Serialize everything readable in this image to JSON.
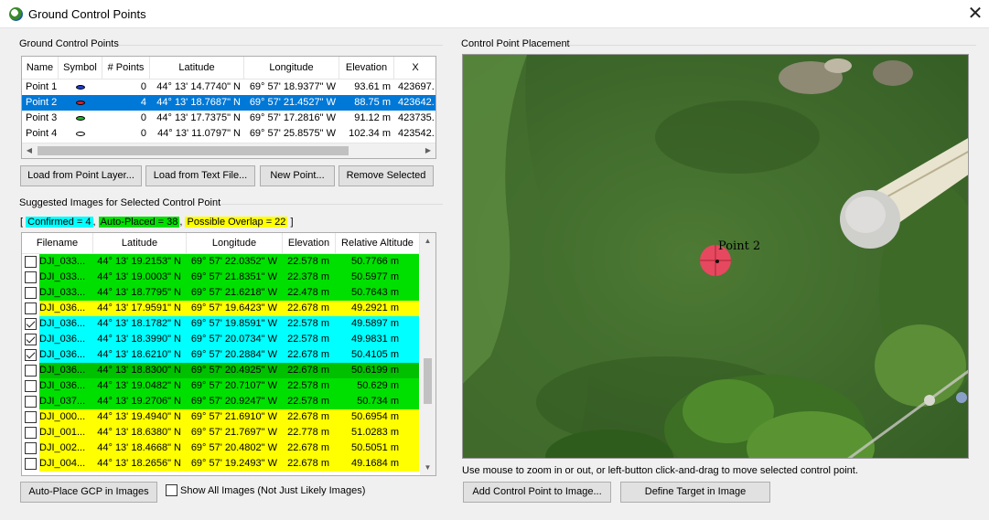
{
  "window": {
    "title": "Ground Control Points",
    "close_glyph": "✕"
  },
  "gcp_group": {
    "label": "Ground Control Points",
    "columns": [
      "Name",
      "Symbol",
      "# Points",
      "Latitude",
      "Longitude",
      "Elevation",
      "X"
    ],
    "rows": [
      {
        "name": "Point 1",
        "symbol_color": "#1a3fd6",
        "points": "0",
        "lat": "44° 13' 14.7740\" N",
        "lon": "69° 57' 18.9377\" W",
        "elev": "93.61 m",
        "x": "423697.",
        "selected": false
      },
      {
        "name": "Point 2",
        "symbol_color": "#e01e2e",
        "points": "4",
        "lat": "44° 13' 18.7687\" N",
        "lon": "69° 57' 21.4527\" W",
        "elev": "88.75 m",
        "x": "423642.",
        "selected": true
      },
      {
        "name": "Point 3",
        "symbol_color": "#1fb52a",
        "points": "0",
        "lat": "44° 13' 17.7375\" N",
        "lon": "69° 57' 17.2816\" W",
        "elev": "91.12 m",
        "x": "423735.",
        "selected": false
      },
      {
        "name": "Point 4",
        "symbol_color": "#ffffff",
        "points": "0",
        "lat": "44° 13' 11.0797\" N",
        "lon": "69° 57' 25.8575\" W",
        "elev": "102.34 m",
        "x": "423542.",
        "selected": false
      }
    ],
    "buttons": {
      "load_point_layer": "Load from Point Layer...",
      "load_text_file": "Load from Text File...",
      "new_point": "New Point...",
      "remove_selected": "Remove Selected"
    }
  },
  "images_group": {
    "label": "Suggested Images for Selected Control Point",
    "legend": {
      "open": "[",
      "confirmed": "Confirmed = 4",
      "auto_placed": "Auto-Placed = 38",
      "overlap": "Possible Overlap = 22",
      "close": "]",
      "sep": ","
    },
    "colors": {
      "confirmed": "#00ffff",
      "auto_placed": "#00e000",
      "overlap": "#ffff00",
      "selected_row": "#00c000"
    },
    "columns": [
      "Filename",
      "Latitude",
      "Longitude",
      "Elevation",
      "Relative Altitude"
    ],
    "rows": [
      {
        "file": "DJI_033...",
        "lat": "44° 13' 19.2153\" N",
        "lon": "69° 57' 22.0352\" W",
        "elev": "22.578 m",
        "rel": "50.7766 m",
        "checked": false,
        "status": "auto_placed"
      },
      {
        "file": "DJI_033...",
        "lat": "44° 13' 19.0003\" N",
        "lon": "69° 57' 21.8351\" W",
        "elev": "22.378 m",
        "rel": "50.5977 m",
        "checked": false,
        "status": "auto_placed"
      },
      {
        "file": "DJI_033...",
        "lat": "44° 13' 18.7795\" N",
        "lon": "69° 57' 21.6218\" W",
        "elev": "22.478 m",
        "rel": "50.7643 m",
        "checked": false,
        "status": "auto_placed"
      },
      {
        "file": "DJI_036...",
        "lat": "44° 13' 17.9591\" N",
        "lon": "69° 57' 19.6423\" W",
        "elev": "22.678 m",
        "rel": "49.2921 m",
        "checked": false,
        "status": "overlap"
      },
      {
        "file": "DJI_036...",
        "lat": "44° 13' 18.1782\" N",
        "lon": "69° 57' 19.8591\" W",
        "elev": "22.578 m",
        "rel": "49.5897 m",
        "checked": true,
        "status": "confirmed"
      },
      {
        "file": "DJI_036...",
        "lat": "44° 13' 18.3990\" N",
        "lon": "69° 57' 20.0734\" W",
        "elev": "22.578 m",
        "rel": "49.9831 m",
        "checked": true,
        "status": "confirmed"
      },
      {
        "file": "DJI_036...",
        "lat": "44° 13' 18.6210\" N",
        "lon": "69° 57' 20.2884\" W",
        "elev": "22.678 m",
        "rel": "50.4105 m",
        "checked": true,
        "status": "confirmed"
      },
      {
        "file": "DJI_036...",
        "lat": "44° 13' 18.8300\" N",
        "lon": "69° 57' 20.4925\" W",
        "elev": "22.678 m",
        "rel": "50.6199 m",
        "checked": false,
        "status": "selected_row"
      },
      {
        "file": "DJI_036...",
        "lat": "44° 13' 19.0482\" N",
        "lon": "69° 57' 20.7107\" W",
        "elev": "22.578 m",
        "rel": "50.629 m",
        "checked": false,
        "status": "auto_placed"
      },
      {
        "file": "DJI_037...",
        "lat": "44° 13' 19.2706\" N",
        "lon": "69° 57' 20.9247\" W",
        "elev": "22.578 m",
        "rel": "50.734 m",
        "checked": false,
        "status": "auto_placed"
      },
      {
        "file": "DJI_000...",
        "lat": "44° 13' 19.4940\" N",
        "lon": "69° 57' 21.6910\" W",
        "elev": "22.678 m",
        "rel": "50.6954 m",
        "checked": false,
        "status": "overlap"
      },
      {
        "file": "DJI_001...",
        "lat": "44° 13' 18.6380\" N",
        "lon": "69° 57' 21.7697\" W",
        "elev": "22.778 m",
        "rel": "51.0283 m",
        "checked": false,
        "status": "overlap"
      },
      {
        "file": "DJI_002...",
        "lat": "44° 13' 18.4668\" N",
        "lon": "69° 57' 20.4802\" W",
        "elev": "22.678 m",
        "rel": "50.5051 m",
        "checked": false,
        "status": "overlap"
      },
      {
        "file": "DJI_004...",
        "lat": "44° 13' 18.2656\" N",
        "lon": "69° 57' 19.2493\" W",
        "elev": "22.678 m",
        "rel": "49.1684 m",
        "checked": false,
        "status": "overlap"
      }
    ],
    "auto_place_button": "Auto-Place GCP in Images",
    "show_all_label": "Show All Images (Not Just Likely Images)",
    "show_all_checked": false
  },
  "placement_group": {
    "label": "Control Point Placement",
    "point_label": "Point 2",
    "hint": "Use mouse to zoom in or out, or left-button click-and-drag to move selected control point.",
    "add_button": "Add Control Point to Image...",
    "define_button": "Define Target in Image"
  }
}
